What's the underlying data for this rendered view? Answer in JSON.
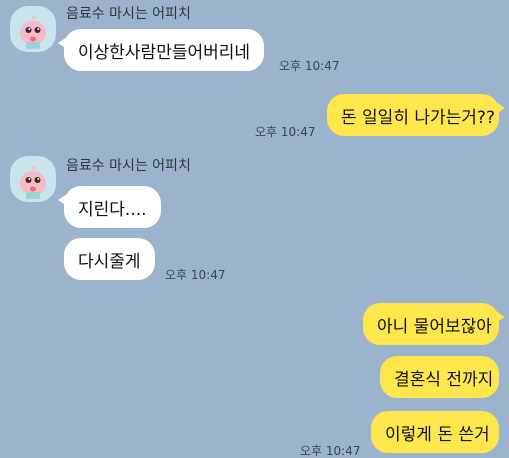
{
  "colors": {
    "background": "#9bb3cc",
    "incoming_bubble": "#ffffff",
    "outgoing_bubble": "#fde74c",
    "avatar_bg": "#c9e4ec"
  },
  "avatar_icon": "peach-character-icon",
  "messages": [
    {
      "sender": "음료수 마시는 어피치",
      "text": "이상한사람만들어버리네",
      "time": "오후 10:47"
    },
    {
      "text": "돈 일일히 나가는거??",
      "time": "오후 10:47"
    },
    {
      "sender": "음료수 마시는 어피치",
      "text": "지린다....",
      "text2": "다시줄게",
      "time": "오후 10:47"
    },
    {
      "text": "아니 물어보잖아",
      "text2": "결혼식 전까지",
      "text3": "이렇게 돈 쓴거",
      "time": "오후 10:47"
    }
  ]
}
